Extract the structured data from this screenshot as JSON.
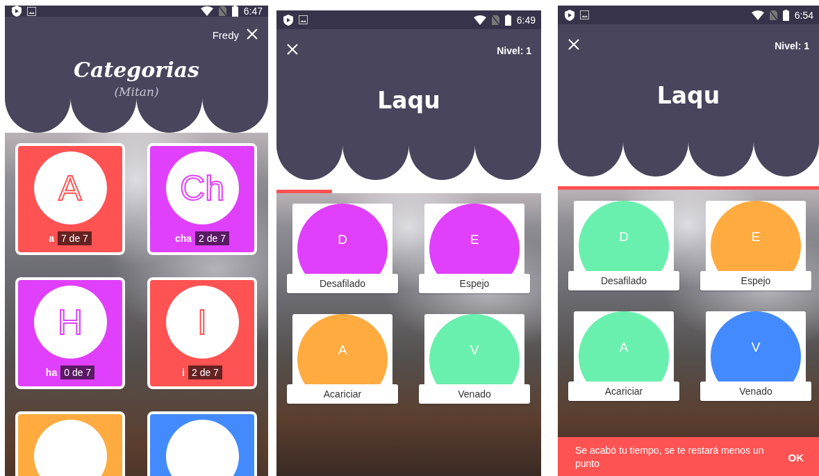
{
  "screens": [
    {
      "kind": "categories",
      "status_bar": {
        "time": "6:47"
      },
      "user": "Fredy",
      "title": "Categorias",
      "subtitle": "(Mitan)",
      "categories": [
        {
          "letter": "A",
          "name": "a",
          "progress": "7 de 7",
          "color": "#ff5252"
        },
        {
          "letter": "Ch",
          "name": "cha",
          "progress": "2 de 7",
          "color": "#e040fb"
        },
        {
          "letter": "H",
          "name": "ha",
          "progress": "0 de 7",
          "color": "#e040fb"
        },
        {
          "letter": "I",
          "name": "i",
          "progress": "2 de 7",
          "color": "#ff5252"
        },
        {
          "color": "#ffab40"
        },
        {
          "color": "#448aff"
        }
      ]
    },
    {
      "kind": "quiz",
      "status_bar": {
        "time": "6:49"
      },
      "level_label": "Nivel: 1",
      "title": "Laqu",
      "timer": {
        "level": 0.21
      },
      "options": [
        {
          "letter": "D",
          "word": "Desafilado",
          "color": "#e040fb"
        },
        {
          "letter": "E",
          "word": "Espejo",
          "color": "#e040fb"
        },
        {
          "letter": "A",
          "word": "Acariciar",
          "color": "#ffab40"
        },
        {
          "letter": "V",
          "word": "Venado",
          "color": "#69f0ae"
        }
      ]
    },
    {
      "kind": "quiz",
      "status_bar": {
        "time": "6:54"
      },
      "level_label": "Nivel: 1",
      "title": "Laqu",
      "timer": {
        "level": 1
      },
      "options": [
        {
          "letter": "D",
          "word": "Desafilado",
          "color": "#69f0ae"
        },
        {
          "letter": "E",
          "word": "Espejo",
          "color": "#ffab40"
        },
        {
          "letter": "A",
          "word": "Acariciar",
          "color": "#69f0ae"
        },
        {
          "letter": "V",
          "word": "Venado",
          "color": "#448aff"
        }
      ],
      "snackbar": {
        "message": "Se acabó tu tiempo, se te restará menos un punto",
        "action": "OK"
      }
    }
  ]
}
